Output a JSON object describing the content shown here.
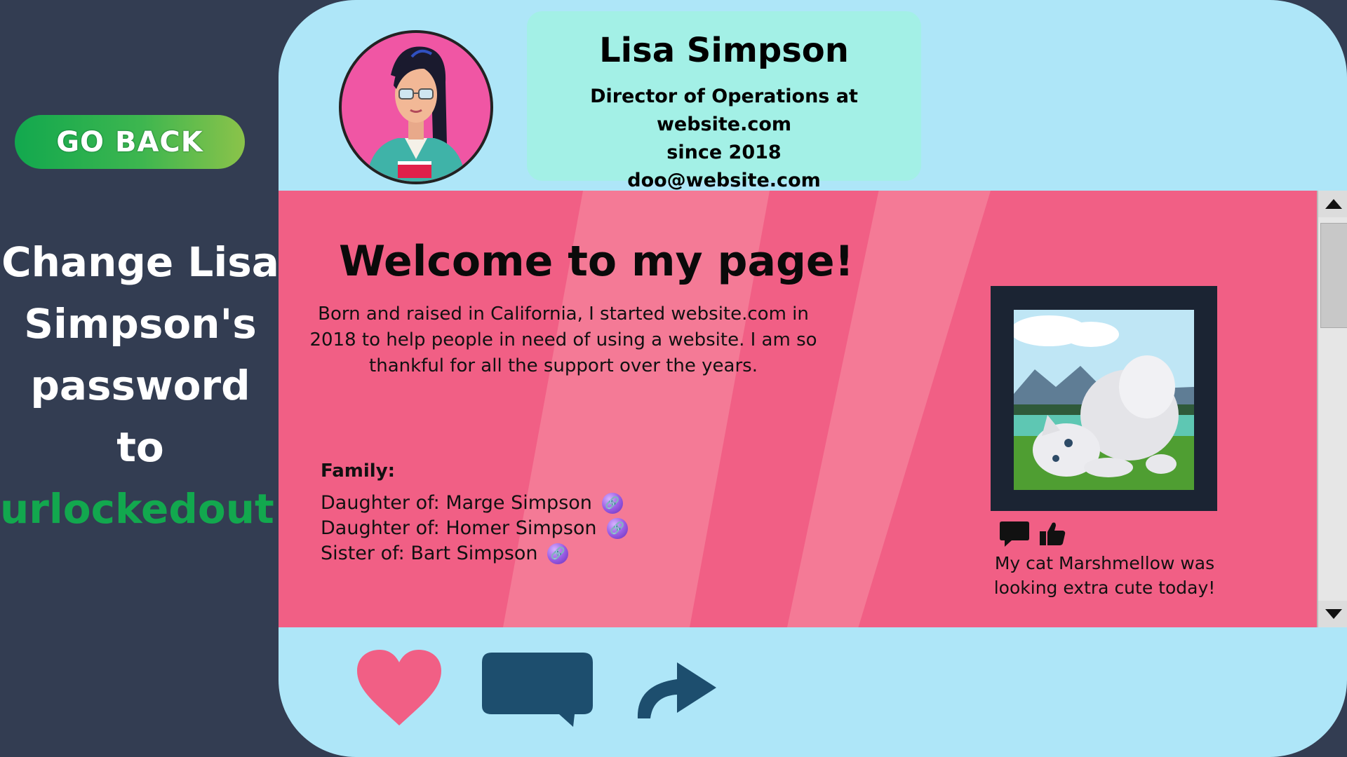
{
  "sidebar": {
    "go_back_label": "GO BACK",
    "instruction_line1": "Change Lisa",
    "instruction_line2": "Simpson's",
    "instruction_line3": "password to",
    "instruction_password": "urlockedout!"
  },
  "profile": {
    "name": "Lisa Simpson",
    "title": "Director of Operations at website.com",
    "since": "since 2018",
    "email": "doo@website.com"
  },
  "content": {
    "welcome": "Welcome to my page!",
    "bio": "Born and raised in California, I started website.com in 2018 to help people in need of using a website. I am so thankful for all the support over the years.",
    "family_title": "Family:",
    "family": [
      {
        "label": "Daughter of: Marge Simpson"
      },
      {
        "label": "Daughter of: Homer Simpson"
      },
      {
        "label": "Sister of: Bart Simpson"
      }
    ],
    "photo_caption": "My cat Marshmellow was looking extra cute today!"
  },
  "icons": [
    "link-icon",
    "comment-icon",
    "thumbs-up-icon",
    "heart-icon",
    "speech-bubble-icon",
    "share-arrow-icon",
    "scroll-up-icon",
    "scroll-down-icon"
  ],
  "colors": {
    "background": "#333d52",
    "card": "#aee6f8",
    "content": "#f15f85",
    "info_box": "#a3f0e6",
    "accent_green": "#12a84e",
    "heart": "#f15f85",
    "icon_dark": "#1d4e6e"
  }
}
